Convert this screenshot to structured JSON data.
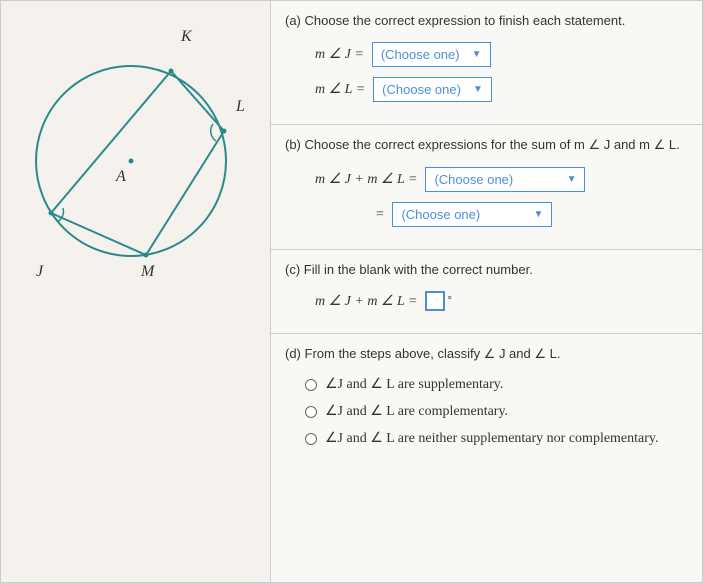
{
  "diagram": {
    "points": {
      "K": "K",
      "L": "L",
      "A": "A",
      "J": "J",
      "M": "M"
    }
  },
  "partA": {
    "prompt": "(a) Choose the correct expression to finish each statement.",
    "row1_lhs": "m ∠ J  =",
    "row2_lhs": "m ∠ L  =",
    "dropdown_text": "(Choose one)"
  },
  "partB": {
    "prompt": "(b) Choose the correct expressions for the sum of m ∠ J and m ∠ L.",
    "row1_lhs": "m ∠ J + m ∠ L   =",
    "row2_lhs": "=",
    "dropdown_text": "(Choose one)"
  },
  "partC": {
    "prompt": "(c) Fill in the blank with the correct number.",
    "lhs": "m ∠ J + m ∠ L   =",
    "degree": "°"
  },
  "partD": {
    "prompt": "(d) From the steps above, classify ∠ J and ∠ L.",
    "opt1": "∠J and ∠ L are supplementary.",
    "opt2": "∠J and ∠ L are complementary.",
    "opt3": "∠J and ∠ L are neither supplementary nor complementary."
  }
}
